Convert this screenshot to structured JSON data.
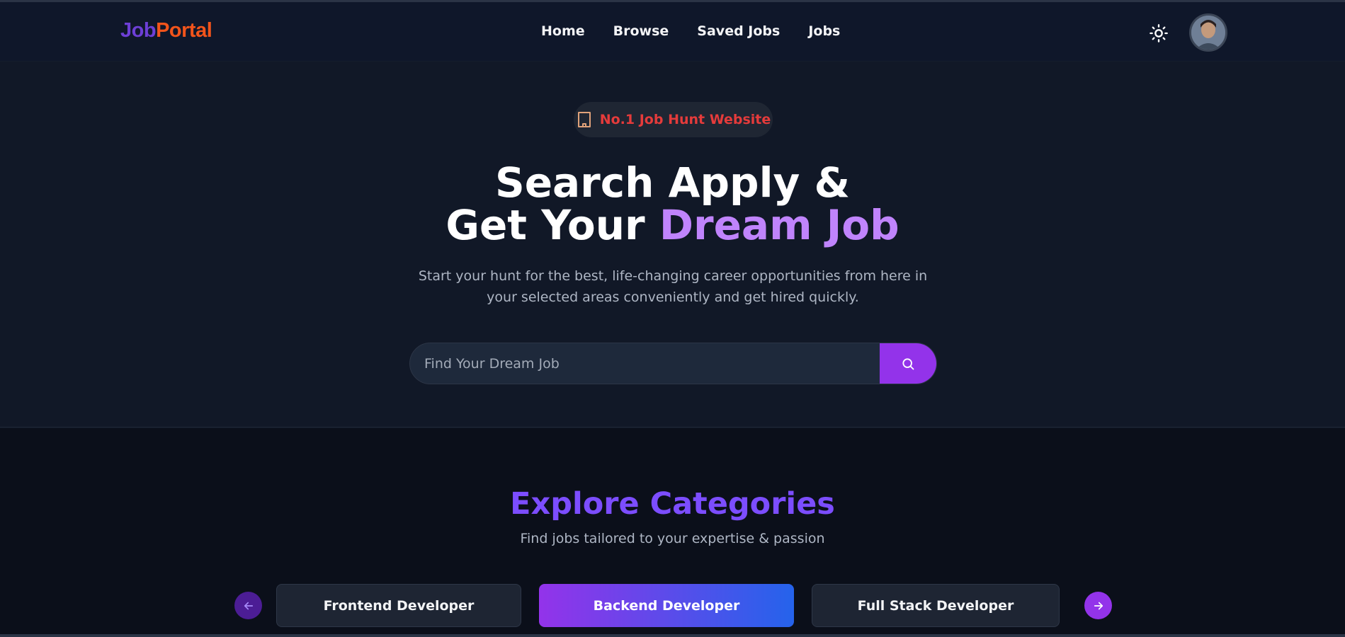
{
  "navbar": {
    "logo_part1": "Job",
    "logo_part2": "Portal",
    "links": [
      "Home",
      "Browse",
      "Saved Jobs",
      "Jobs"
    ],
    "theme_icon": "sun-icon",
    "avatar_icon": "user-avatar"
  },
  "hero": {
    "badge_icon": "building-icon",
    "badge_text": "No.1 Job Hunt Website",
    "headline_line1": "Search Apply &",
    "headline_line2_start": "Get Your ",
    "headline_accent": "Dream Job",
    "subtext": "Start your hunt for the best, life-changing career opportunities from here in your selected areas conveniently and get hired quickly.",
    "search_placeholder": "Find Your Dream Job",
    "search_icon": "search-icon"
  },
  "categories": {
    "title": "Explore Categories",
    "subtitle": "Find jobs tailored to your expertise & passion",
    "items": [
      "Frontend Developer",
      "Backend Developer",
      "Full Stack Developer"
    ],
    "active_index": 1,
    "prev_icon": "arrow-left-icon",
    "next_icon": "arrow-right-icon"
  },
  "colors": {
    "logo_job": "#6d3fd6",
    "logo_portal": "#f2541b",
    "accent_purple": "#9333ea",
    "headline_accent": "#c084fc",
    "badge_text": "#e53b3b",
    "category_title": "#7c4dff"
  }
}
